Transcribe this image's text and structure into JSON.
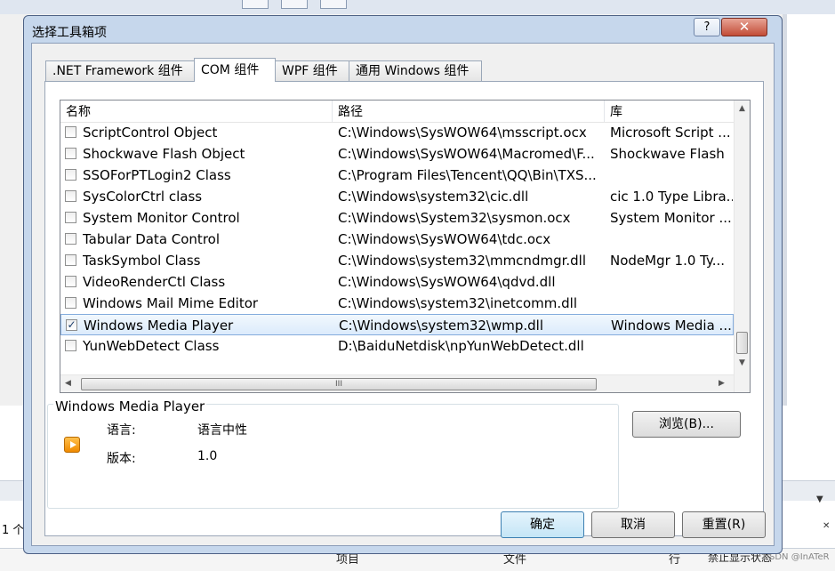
{
  "background": {
    "left_text": "1 个",
    "bottom_columns": [
      "项目",
      "文件",
      "行",
      "禁止显示状态"
    ],
    "watermark": "CSDN @InATeR"
  },
  "dialog": {
    "title": "选择工具箱项",
    "help_label": "?",
    "close_label": "✕",
    "tabs": [
      {
        "label": ".NET Framework 组件",
        "active": false
      },
      {
        "label": "COM 组件",
        "active": true
      },
      {
        "label": "WPF 组件",
        "active": false
      },
      {
        "label": "通用 Windows 组件",
        "active": false
      }
    ],
    "list": {
      "columns": [
        "名称",
        "路径",
        "库"
      ],
      "rows": [
        {
          "name": "ScriptControl Object",
          "path": "C:\\Windows\\SysWOW64\\msscript.ocx",
          "lib": "Microsoft Script ...",
          "checked": false,
          "selected": false
        },
        {
          "name": "Shockwave Flash Object",
          "path": "C:\\Windows\\SysWOW64\\Macromed\\F...",
          "lib": "Shockwave Flash",
          "checked": false,
          "selected": false
        },
        {
          "name": "SSOForPTLogin2 Class",
          "path": "C:\\Program Files\\Tencent\\QQ\\Bin\\TXS...",
          "lib": "",
          "checked": false,
          "selected": false
        },
        {
          "name": "SysColorCtrl class",
          "path": "C:\\Windows\\system32\\cic.dll",
          "lib": "cic 1.0 Type Libra...",
          "checked": false,
          "selected": false
        },
        {
          "name": "System Monitor Control",
          "path": "C:\\Windows\\System32\\sysmon.ocx",
          "lib": "System Monitor ...",
          "checked": false,
          "selected": false
        },
        {
          "name": "Tabular Data Control",
          "path": "C:\\Windows\\SysWOW64\\tdc.ocx",
          "lib": "",
          "checked": false,
          "selected": false
        },
        {
          "name": "TaskSymbol Class",
          "path": "C:\\Windows\\system32\\mmcndmgr.dll",
          "lib": "NodeMgr 1.0 Ty...",
          "checked": false,
          "selected": false
        },
        {
          "name": "VideoRenderCtl Class",
          "path": "C:\\Windows\\SysWOW64\\qdvd.dll",
          "lib": "",
          "checked": false,
          "selected": false
        },
        {
          "name": "Windows Mail Mime Editor",
          "path": "C:\\Windows\\system32\\inetcomm.dll",
          "lib": "",
          "checked": false,
          "selected": false
        },
        {
          "name": "Windows Media Player",
          "path": "C:\\Windows\\system32\\wmp.dll",
          "lib": "Windows Media ...",
          "checked": true,
          "selected": true
        },
        {
          "name": "YunWebDetect Class",
          "path": "D:\\BaiduNetdisk\\npYunWebDetect.dll",
          "lib": "",
          "checked": false,
          "selected": false
        }
      ],
      "hscroll_grip": "III"
    },
    "info": {
      "title": "Windows Media Player",
      "language_label": "语言:",
      "language_value": "语言中性",
      "version_label": "版本:",
      "version_value": "1.0"
    },
    "browse_button": "浏览(B)...",
    "ok_button": "确定",
    "cancel_button": "取消",
    "reset_button": "重置(R)"
  }
}
